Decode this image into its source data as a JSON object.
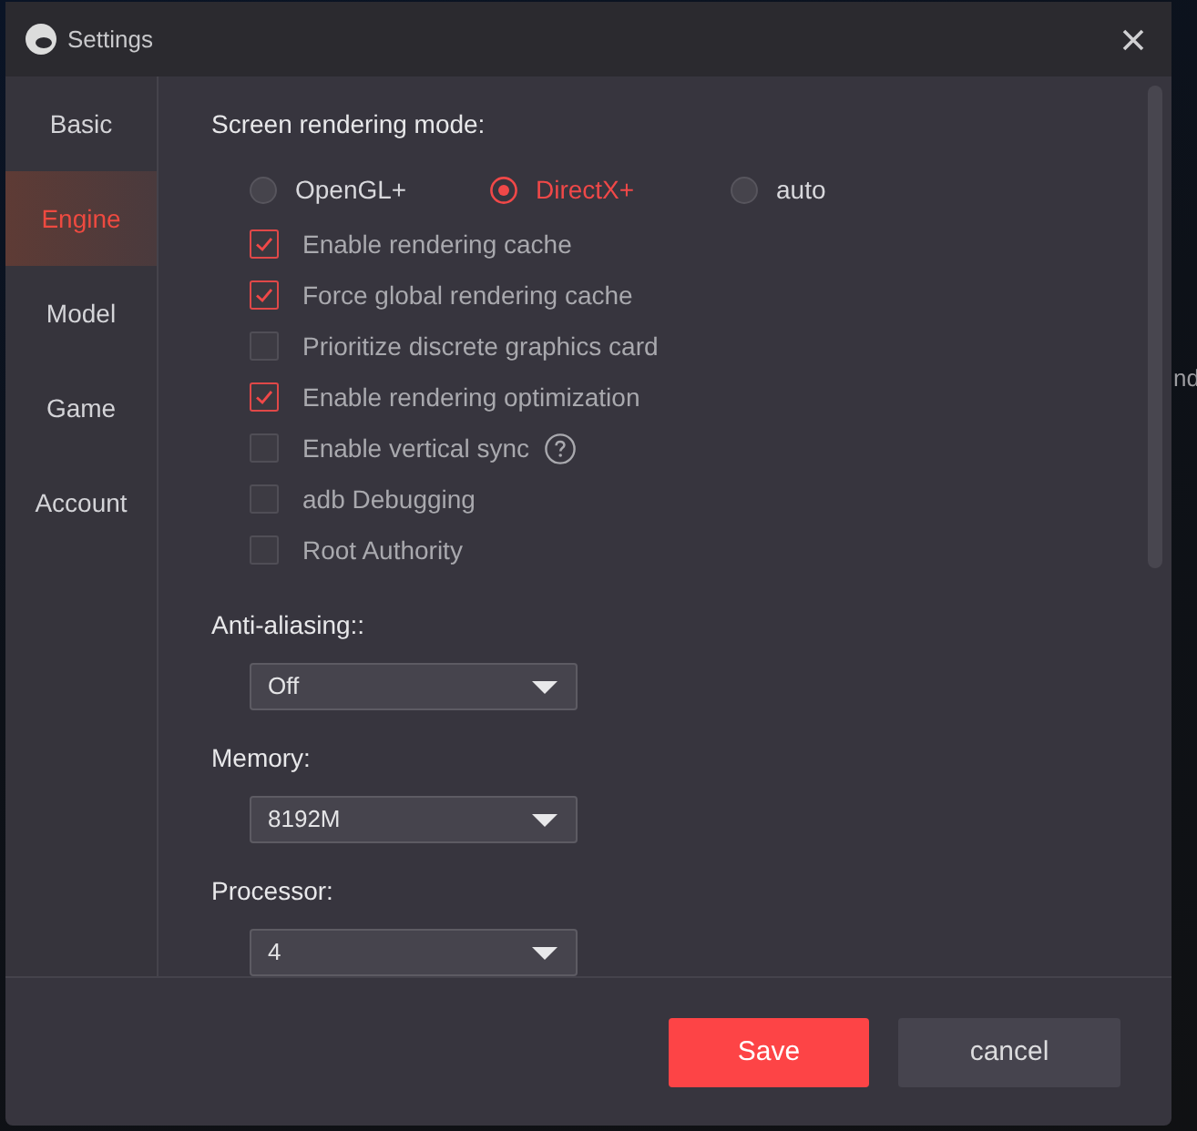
{
  "window": {
    "title": "Settings"
  },
  "background": {
    "text": "nd"
  },
  "sidebar": {
    "items": [
      {
        "label": "Basic",
        "selected": false
      },
      {
        "label": "Engine",
        "selected": true
      },
      {
        "label": "Model",
        "selected": false
      },
      {
        "label": "Game",
        "selected": false
      },
      {
        "label": "Account",
        "selected": false
      }
    ]
  },
  "rendering_mode": {
    "label": "Screen rendering mode:",
    "options": [
      {
        "label": "OpenGL+",
        "selected": false
      },
      {
        "label": "DirectX+",
        "selected": true
      },
      {
        "label": "auto",
        "selected": false
      }
    ]
  },
  "checkboxes": [
    {
      "label": "Enable rendering cache",
      "checked": true
    },
    {
      "label": "Force global rendering cache",
      "checked": true
    },
    {
      "label": "Prioritize discrete graphics card",
      "checked": false
    },
    {
      "label": "Enable rendering optimization",
      "checked": true
    },
    {
      "label": "Enable vertical sync",
      "checked": false,
      "help": true
    },
    {
      "label": "adb Debugging",
      "checked": false
    },
    {
      "label": "Root Authority",
      "checked": false
    }
  ],
  "dropdowns": [
    {
      "label": "Anti-aliasing::",
      "value": "Off"
    },
    {
      "label": "Memory:",
      "value": "8192M"
    },
    {
      "label": "Processor:",
      "value": "4"
    }
  ],
  "buttons": [
    {
      "label": "Save",
      "kind": "primary"
    },
    {
      "label": "cancel",
      "kind": "secondary"
    }
  ]
}
